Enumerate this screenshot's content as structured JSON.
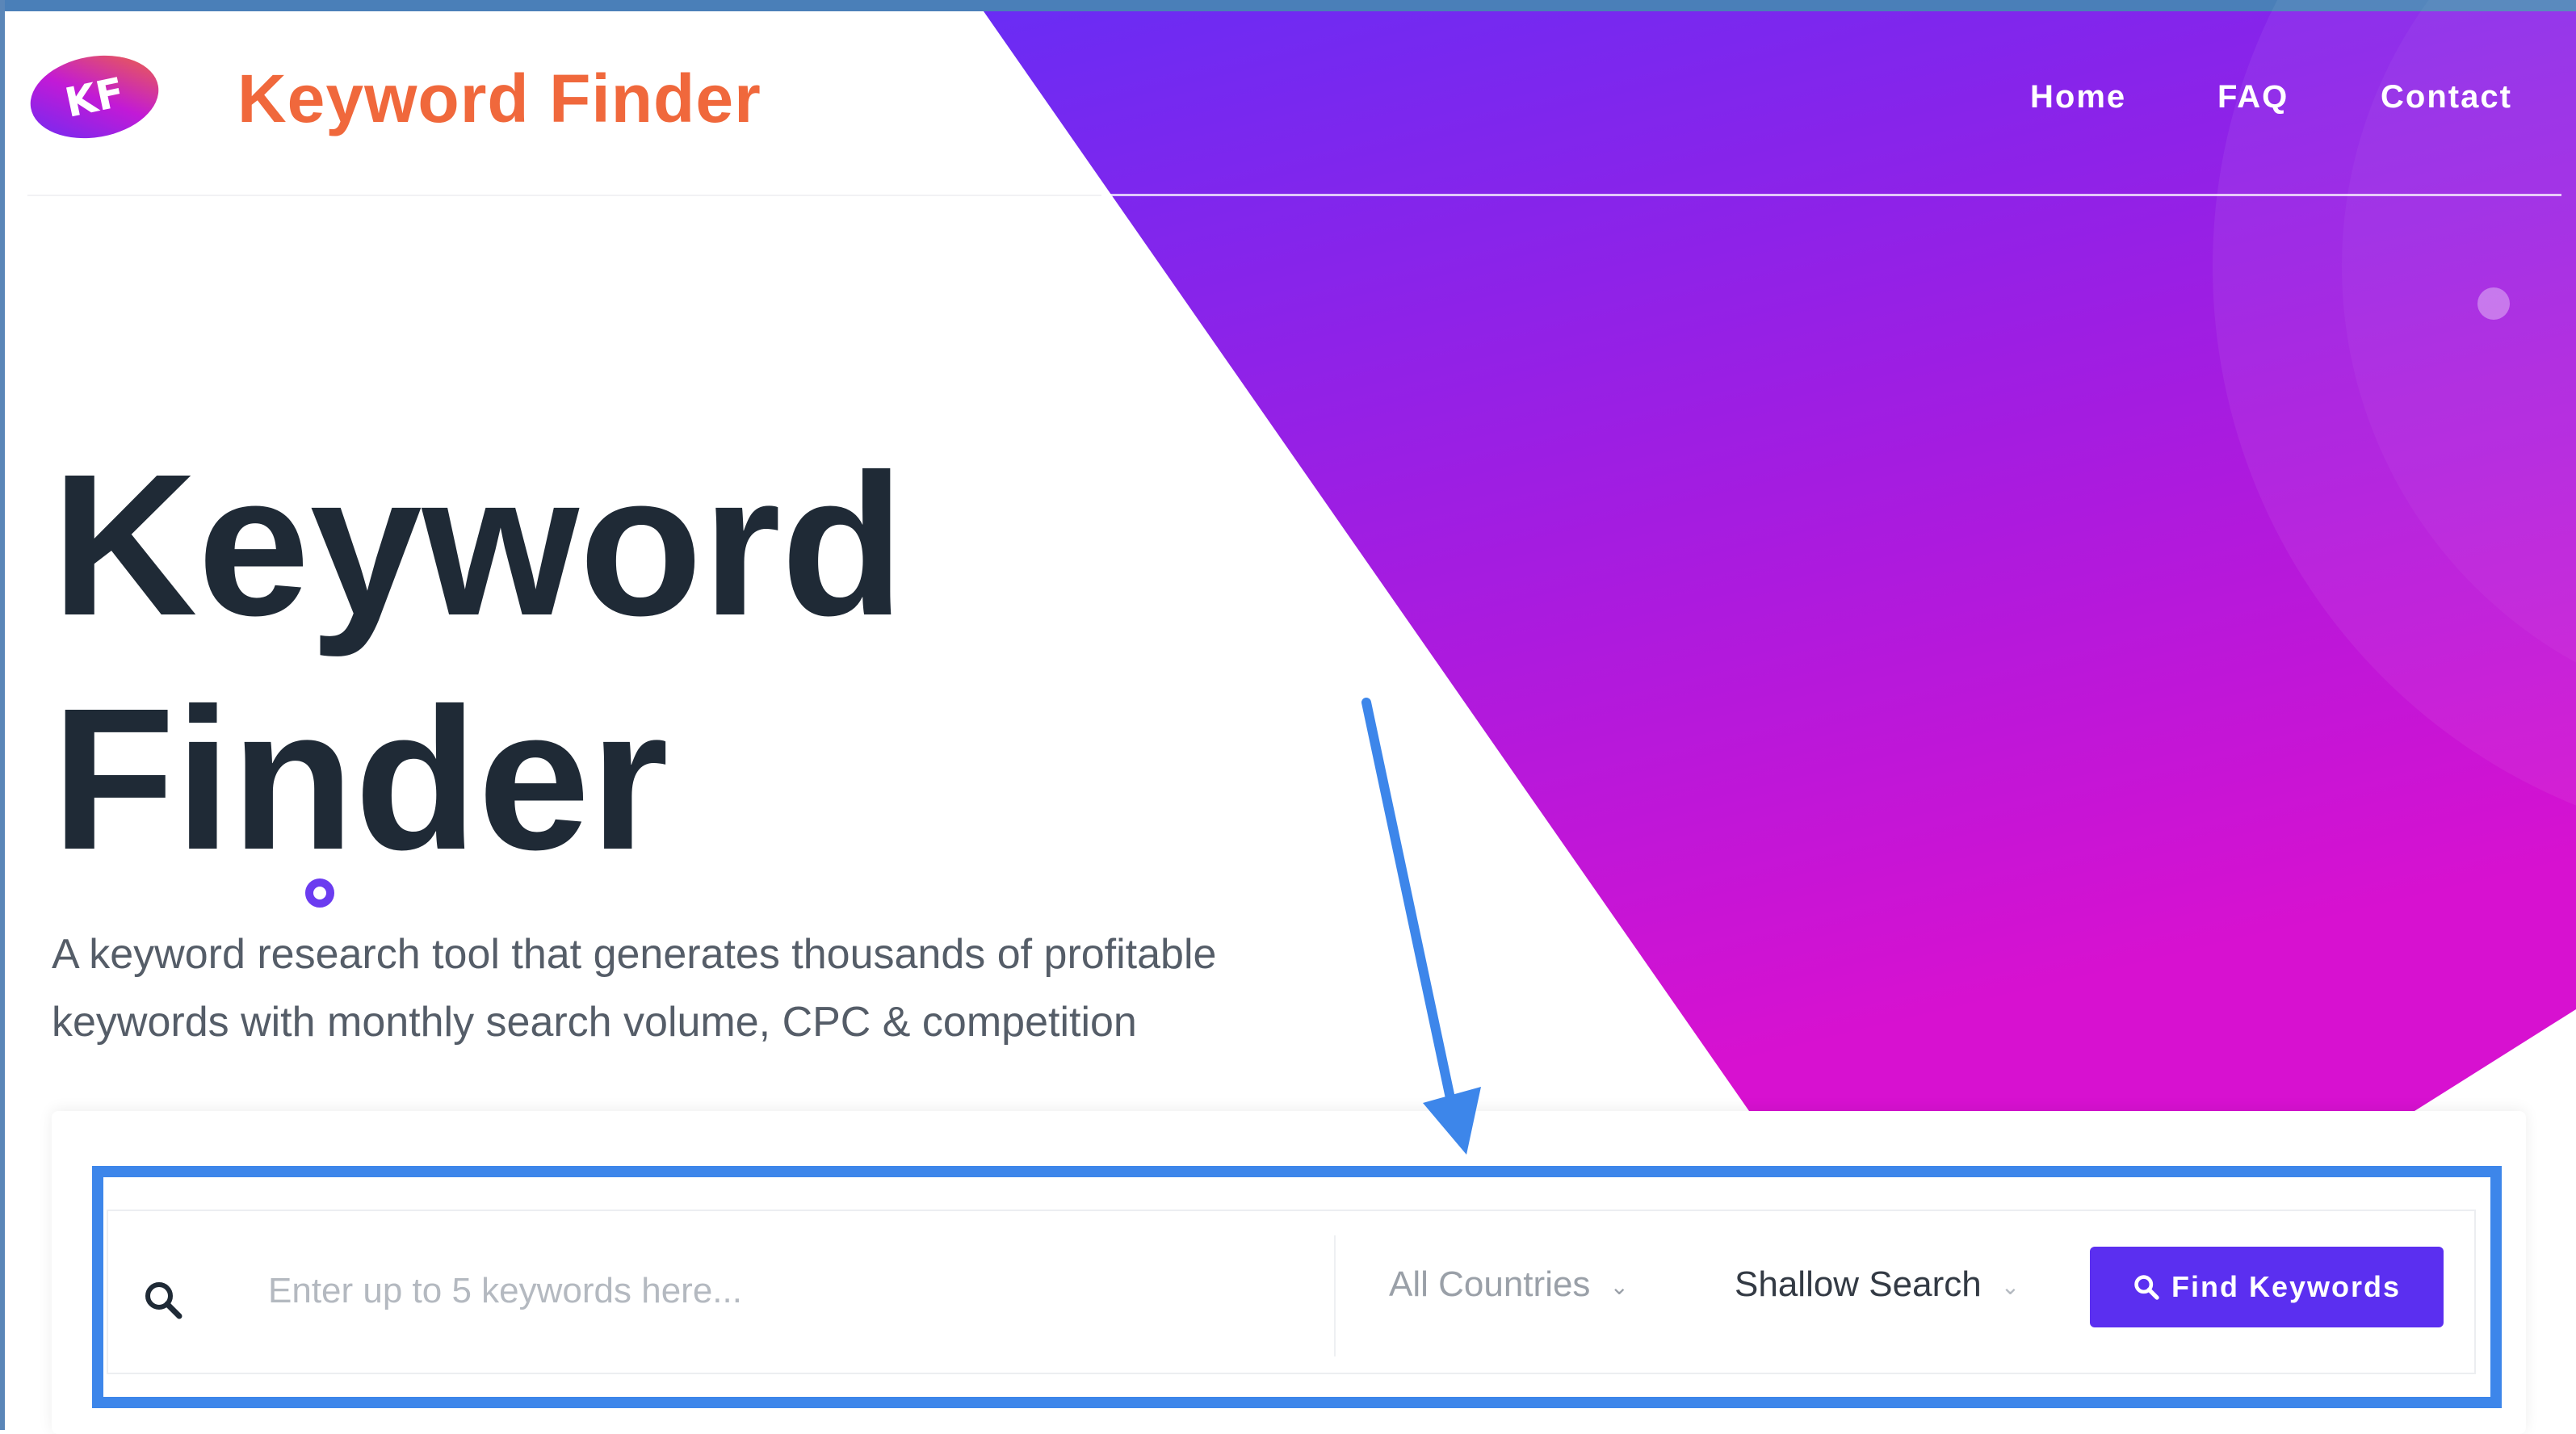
{
  "brand": {
    "logo_text": "KF",
    "name": "Keyword Finder"
  },
  "nav": {
    "home": "Home",
    "faq": "FAQ",
    "contact": "Contact"
  },
  "hero": {
    "title_line1": "Keyword",
    "title_line2": "Finder",
    "subtitle_line1": "A keyword research tool that generates thousands of profitable",
    "subtitle_line2": "keywords with monthly search volume, CPC & competition"
  },
  "search": {
    "placeholder": "Enter up to 5 keywords here...",
    "country": "All Countries",
    "mode": "Shallow Search",
    "button_label": "Find Keywords"
  },
  "icons": {
    "search": "search-icon",
    "country_chevron": "chevron-down-icon",
    "mode_chevron": "chevron-down-icon",
    "button": "search-icon"
  },
  "colors": {
    "brand_orange": "#f0683c",
    "gradient_top": "#6a2cf4",
    "gradient_bottom": "#d711d0",
    "button": "#5b2ff0",
    "annotation_blue": "#3d86ea"
  }
}
